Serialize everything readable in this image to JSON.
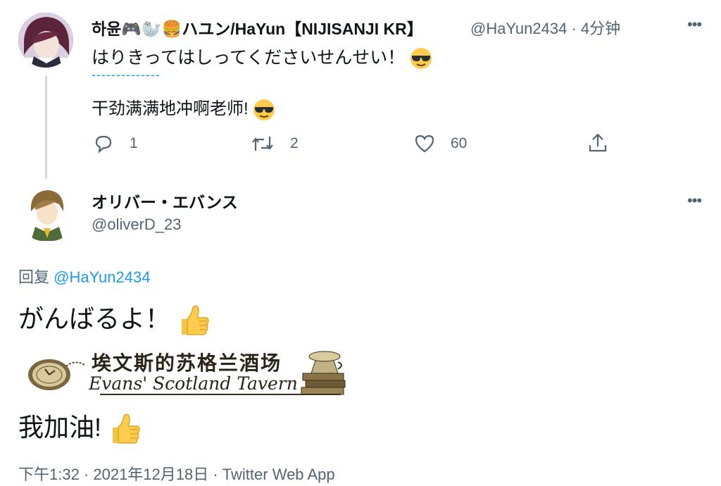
{
  "parent_tweet": {
    "display_name": "하윤🎮🦭🍔ハユン/HaYun【NIJISANJI KR】",
    "handle": "@HaYun2434",
    "separator": "·",
    "time": "4分钟",
    "text_ja": "はりきってはしってくださいせんせい！",
    "divider": "--------------",
    "text_zh": "干劲满满地冲啊老师!",
    "reply_count": "1",
    "retweet_count": "2",
    "like_count": "60"
  },
  "reply_tweet": {
    "display_name": "オリバー・エバンス",
    "handle": "@oliverD_23",
    "reply_prefix": "回复",
    "reply_to": "@HaYun2434",
    "text_ja": "がんばるよ！",
    "banner_zh": "埃文斯的苏格兰酒场",
    "banner_en": "Evans' Scotland Tavern",
    "text_zh": "我加油!",
    "timestamp": "下午1:32 · 2021年12月18日 · Twitter Web App"
  },
  "colors": {
    "link": "#1d9bf0",
    "muted": "#536471",
    "line": "#cfd9de"
  }
}
